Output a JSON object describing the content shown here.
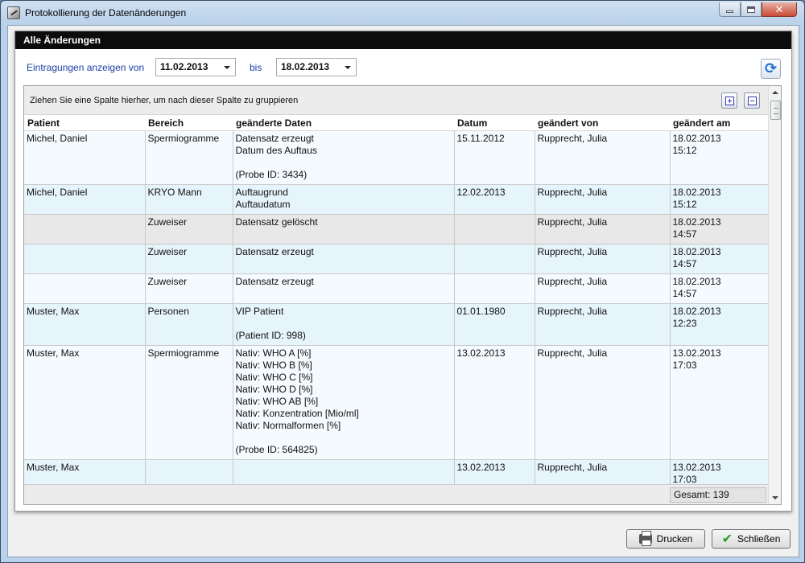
{
  "window": {
    "title": "Protokollierung der Datenänderungen"
  },
  "panel": {
    "title": "Alle Änderungen"
  },
  "filter": {
    "label": "Eintragungen anzeigen von",
    "from": "11.02.2013",
    "bis": "bis",
    "to": "18.02.2013"
  },
  "grid": {
    "group_hint": "Ziehen Sie eine Spalte hierher, um nach dieser Spalte zu gruppieren",
    "columns": {
      "patient": "Patient",
      "bereich": "Bereich",
      "daten": "geänderte Daten",
      "datum": "Datum",
      "von": "geändert von",
      "am": "geändert am"
    },
    "rows": [
      {
        "patient": "Michel, Daniel",
        "bereich": "Spermiogramme",
        "daten": [
          "Datensatz erzeugt",
          "Datum des Auftaus",
          "",
          "(Probe ID: 3434)"
        ],
        "datum": "15.11.2012",
        "von": "Rupprecht, Julia",
        "am": [
          "18.02.2013",
          "15:12"
        ]
      },
      {
        "patient": "Michel, Daniel",
        "bereich": "KRYO Mann",
        "daten": [
          "Auftaugrund",
          "Auftaudatum"
        ],
        "datum": "12.02.2013",
        "von": "Rupprecht, Julia",
        "am": [
          "18.02.2013",
          "15:12"
        ]
      },
      {
        "patient": "",
        "bereich": "Zuweiser",
        "daten": [
          "Datensatz gelöscht"
        ],
        "datum": "",
        "von": "Rupprecht, Julia",
        "am": [
          "18.02.2013",
          "14:57"
        ]
      },
      {
        "patient": "",
        "bereich": "Zuweiser",
        "daten": [
          "Datensatz erzeugt"
        ],
        "datum": "",
        "von": "Rupprecht, Julia",
        "am": [
          "18.02.2013",
          "14:57"
        ]
      },
      {
        "patient": "",
        "bereich": "Zuweiser",
        "daten": [
          "Datensatz erzeugt"
        ],
        "datum": "",
        "von": "Rupprecht, Julia",
        "am": [
          "18.02.2013",
          "14:57"
        ]
      },
      {
        "patient": "Muster, Max",
        "bereich": "Personen",
        "daten": [
          "VIP Patient",
          "",
          "(Patient ID: 998)"
        ],
        "datum": "01.01.1980",
        "von": "Rupprecht, Julia",
        "am": [
          "18.02.2013",
          "12:23"
        ]
      },
      {
        "patient": "Muster, Max",
        "bereich": "Spermiogramme",
        "daten": [
          "Nativ: WHO A [%]",
          "Nativ: WHO B [%]",
          "Nativ: WHO C [%]",
          "Nativ: WHO D [%]",
          "Nativ: WHO AB [%]",
          "Nativ: Konzentration [Mio/ml]",
          "Nativ: Normalformen [%]",
          "",
          "(Probe ID: 564825)"
        ],
        "datum": "13.02.2013",
        "von": "Rupprecht, Julia",
        "am": [
          "13.02.2013",
          "17:03"
        ]
      },
      {
        "patient": "Muster, Max",
        "bereich": "",
        "daten": [
          ""
        ],
        "datum": "13.02.2013",
        "von": "Rupprecht, Julia",
        "am": [
          "13.02.2013",
          "17:03"
        ]
      }
    ],
    "total": "Gesamt: 139"
  },
  "buttons": {
    "print": "Drucken",
    "close": "Schließen"
  }
}
